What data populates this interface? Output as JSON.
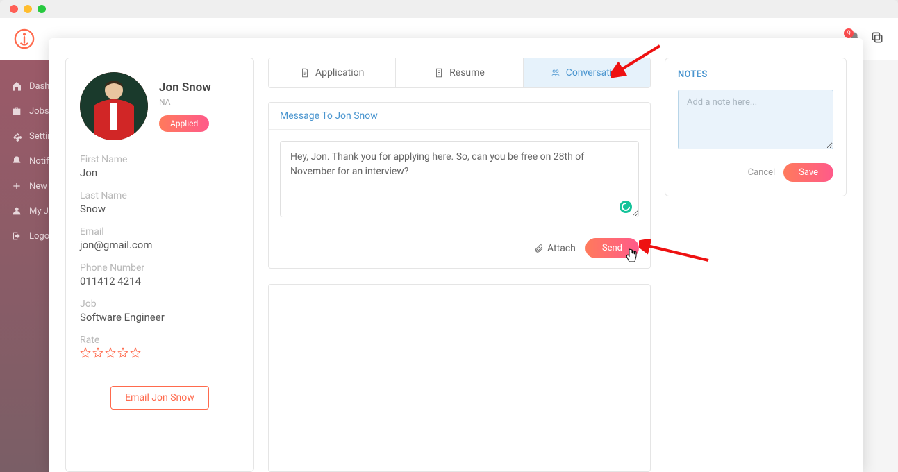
{
  "sidebar": {
    "items": [
      {
        "label": "Dashboard",
        "icon": "home-icon"
      },
      {
        "label": "Jobs",
        "icon": "briefcase-icon"
      },
      {
        "label": "Settings",
        "icon": "gear-icon"
      },
      {
        "label": "Notifications",
        "icon": "bell-icon"
      },
      {
        "label": "New",
        "icon": "plus-icon"
      },
      {
        "label": "My Jobs",
        "icon": "user-icon"
      },
      {
        "label": "Logout",
        "icon": "logout-icon"
      }
    ]
  },
  "topbar": {
    "notification_count": "9"
  },
  "profile": {
    "display_name": "Jon Snow",
    "subtitle": "NA",
    "status_label": "Applied",
    "fields": {
      "first_name_label": "First Name",
      "first_name_value": "Jon",
      "last_name_label": "Last Name",
      "last_name_value": "Snow",
      "email_label": "Email",
      "email_value": "jon@gmail.com",
      "phone_label": "Phone Number",
      "phone_value": "011412 4214",
      "job_label": "Job",
      "job_value": "Software Engineer",
      "rate_label": "Rate"
    },
    "rating": 0,
    "email_button_label": "Email Jon Snow"
  },
  "tabs": {
    "application": "Application",
    "resume": "Resume",
    "conversation": "Conversation",
    "active": "conversation"
  },
  "message": {
    "header": "Message To Jon Snow",
    "body": "Hey, Jon. Thank you for applying here. So, can you be free on 28th of November for an interview?",
    "attach_label": "Attach",
    "send_label": "Send"
  },
  "notes": {
    "title": "NOTES",
    "placeholder": "Add a note here...",
    "cancel_label": "Cancel",
    "save_label": "Save"
  }
}
